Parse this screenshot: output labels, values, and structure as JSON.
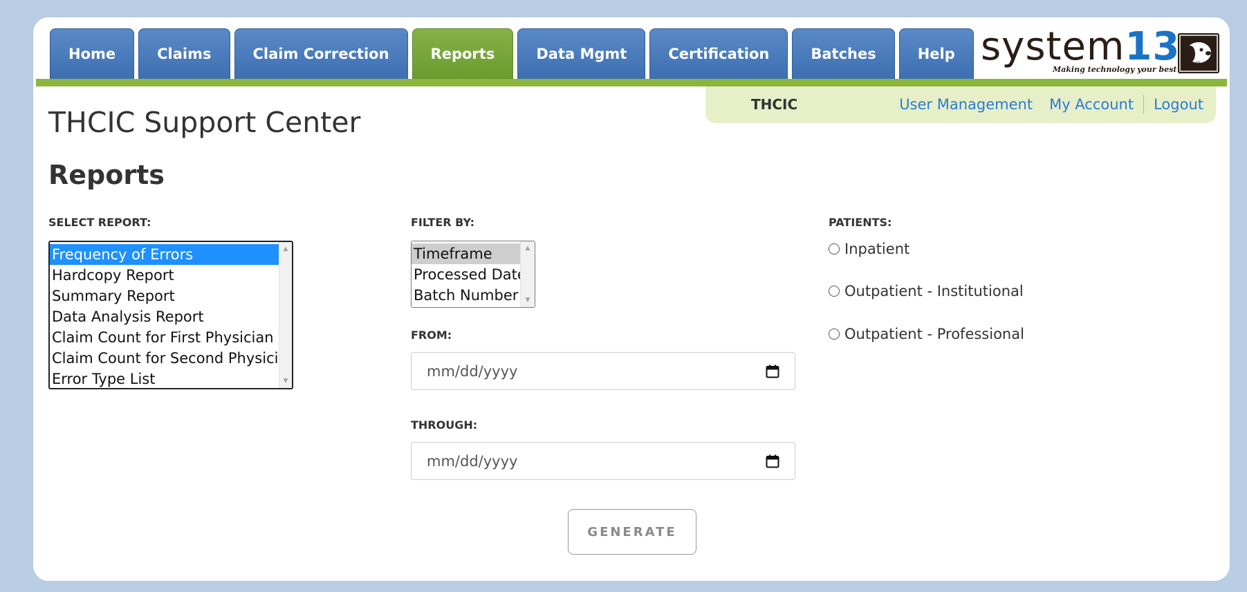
{
  "nav": {
    "tabs": [
      {
        "label": "Home",
        "active": false
      },
      {
        "label": "Claims",
        "active": false
      },
      {
        "label": "Claim Correction",
        "active": false
      },
      {
        "label": "Reports",
        "active": true
      },
      {
        "label": "Data Mgmt",
        "active": false
      },
      {
        "label": "Certification",
        "active": false
      },
      {
        "label": "Batches",
        "active": false
      },
      {
        "label": "Help",
        "active": false
      }
    ]
  },
  "logo": {
    "text_main": "system",
    "text_num": "13",
    "tagline": "Making technology your best friend."
  },
  "infobar": {
    "org": "THCIC",
    "links": {
      "user_management": "User Management",
      "my_account": "My Account",
      "logout": "Logout"
    }
  },
  "site_title": "THCIC Support Center",
  "page_heading": "Reports",
  "select_report": {
    "label": "SELECT REPORT:",
    "options": [
      "Frequency of Errors",
      "Hardcopy Report",
      "Summary Report",
      "Data Analysis Report",
      "Claim Count for First Physician",
      "Claim Count for Second Physician",
      "Error Type List"
    ],
    "selected": "Frequency of Errors"
  },
  "filter_by": {
    "label": "FILTER BY:",
    "options": [
      "Timeframe",
      "Processed Date",
      "Batch Number"
    ],
    "selected": "Timeframe"
  },
  "from": {
    "label": "FROM:",
    "placeholder": "mm/dd/yyyy"
  },
  "through": {
    "label": "THROUGH:",
    "placeholder": "mm/dd/yyyy"
  },
  "patients": {
    "label": "PATIENTS:",
    "options": [
      "Inpatient",
      "Outpatient - Institutional",
      "Outpatient - Professional"
    ]
  },
  "generate_label": "GENERATE",
  "colors": {
    "nav_blue": "#4a7dbf",
    "nav_active_green": "#78a63a",
    "accent_bar": "#8cb63b",
    "link_blue": "#2a7bd3",
    "selection_blue": "#1e90ff"
  }
}
